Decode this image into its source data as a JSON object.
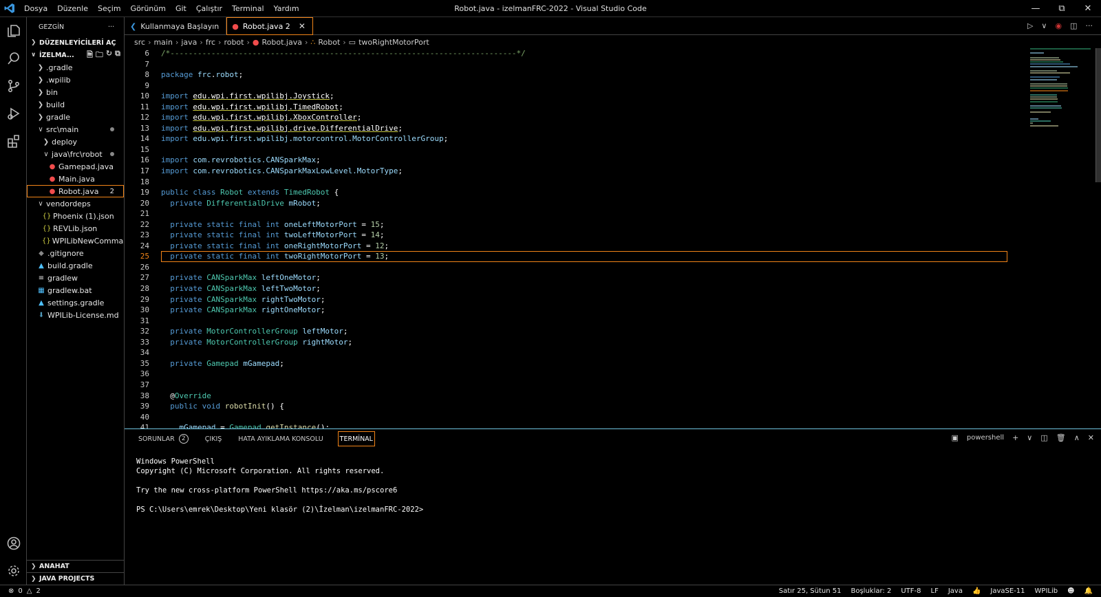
{
  "window": {
    "title": "Robot.java - izelmanFRC-2022 - Visual Studio Code",
    "menu": [
      "Dosya",
      "Düzenle",
      "Seçim",
      "Görünüm",
      "Git",
      "Çalıştır",
      "Terminal",
      "Yardım"
    ]
  },
  "sidebar": {
    "header": "GEZGİN",
    "open_editors": "DÜZENLEYİCİLERİ AÇ",
    "folder": "İZELMA...",
    "tree": [
      {
        "label": ".gradle",
        "depth": 1,
        "kind": "folder",
        "open": false
      },
      {
        "label": ".wpilib",
        "depth": 1,
        "kind": "folder",
        "open": false
      },
      {
        "label": "bin",
        "depth": 1,
        "kind": "folder",
        "open": false
      },
      {
        "label": "build",
        "depth": 1,
        "kind": "folder",
        "open": false
      },
      {
        "label": "gradle",
        "depth": 1,
        "kind": "folder",
        "open": false
      },
      {
        "label": "src\\main",
        "depth": 1,
        "kind": "folder",
        "open": true,
        "dot": true
      },
      {
        "label": "deploy",
        "depth": 2,
        "kind": "folder",
        "open": false
      },
      {
        "label": "java\\frc\\robot",
        "depth": 2,
        "kind": "folder",
        "open": true,
        "dot": true
      },
      {
        "label": "Gamepad.java",
        "depth": 3,
        "kind": "java-error"
      },
      {
        "label": "Main.java",
        "depth": 3,
        "kind": "java-error"
      },
      {
        "label": "Robot.java",
        "depth": 3,
        "kind": "java-error",
        "selected": true,
        "count": "2"
      },
      {
        "label": "vendordeps",
        "depth": 1,
        "kind": "folder",
        "open": true
      },
      {
        "label": "Phoenix (1).json",
        "depth": 2,
        "kind": "json"
      },
      {
        "label": "REVLib.json",
        "depth": 2,
        "kind": "json"
      },
      {
        "label": "WPILibNewComma...",
        "depth": 2,
        "kind": "json"
      },
      {
        "label": ".gitignore",
        "depth": 1,
        "kind": "git"
      },
      {
        "label": "build.gradle",
        "depth": 1,
        "kind": "gradle"
      },
      {
        "label": "gradlew",
        "depth": 1,
        "kind": "text"
      },
      {
        "label": "gradlew.bat",
        "depth": 1,
        "kind": "bat"
      },
      {
        "label": "settings.gradle",
        "depth": 1,
        "kind": "gradle"
      },
      {
        "label": "WPILib-License.md",
        "depth": 1,
        "kind": "md"
      }
    ],
    "outline": "ANAHAT",
    "java_projects": "JAVA PROJECTS"
  },
  "tabs": [
    {
      "label": "Kullanmaya Başlayın",
      "active": false
    },
    {
      "label": "Robot.java 2",
      "active": true
    }
  ],
  "breadcrumb": [
    "src",
    "main",
    "java",
    "frc",
    "robot",
    "Robot.java",
    "Robot",
    "twoRightMotorPort"
  ],
  "editor": {
    "current_line": 25,
    "lines": [
      {
        "n": 6,
        "t": [
          [
            "cm",
            "/*----------------------------------------------------------------------------*/"
          ]
        ]
      },
      {
        "n": 7,
        "t": []
      },
      {
        "n": 8,
        "t": [
          [
            "kw",
            "package "
          ],
          [
            "id",
            "frc"
          ],
          [
            "",
            "."
          ],
          [
            "id",
            "robot"
          ],
          [
            "",
            ";"
          ]
        ]
      },
      {
        "n": 9,
        "t": []
      },
      {
        "n": 10,
        "t": [
          [
            "kw",
            "import "
          ],
          [
            "ul",
            "edu.wpi.first.wpilibj.Joystick"
          ],
          [
            "",
            ";"
          ]
        ]
      },
      {
        "n": 11,
        "t": [
          [
            "kw",
            "import "
          ],
          [
            "ul",
            "edu.wpi.first.wpilibj.TimedRobot"
          ],
          [
            "",
            ";"
          ]
        ]
      },
      {
        "n": 12,
        "t": [
          [
            "kw",
            "import "
          ],
          [
            "ul",
            "edu.wpi.first.wpilibj.XboxController"
          ],
          [
            "",
            ";"
          ]
        ]
      },
      {
        "n": 13,
        "t": [
          [
            "kw",
            "import "
          ],
          [
            "ul",
            "edu.wpi.first.wpilibj.drive.DifferentialDrive"
          ],
          [
            "",
            ";"
          ]
        ]
      },
      {
        "n": 14,
        "t": [
          [
            "kw",
            "import "
          ],
          [
            "id",
            "edu.wpi.first.wpilibj.motorcontrol.MotorControllerGroup"
          ],
          [
            "",
            ";"
          ]
        ]
      },
      {
        "n": 15,
        "t": []
      },
      {
        "n": 16,
        "t": [
          [
            "kw",
            "import "
          ],
          [
            "id",
            "com.revrobotics.CANSparkMax"
          ],
          [
            "",
            ";"
          ]
        ]
      },
      {
        "n": 17,
        "t": [
          [
            "kw",
            "import "
          ],
          [
            "id",
            "com.revrobotics.CANSparkMaxLowLevel.MotorType"
          ],
          [
            "",
            ";"
          ]
        ]
      },
      {
        "n": 18,
        "t": []
      },
      {
        "n": 19,
        "t": [
          [
            "kw",
            "public class "
          ],
          [
            "ty",
            "Robot"
          ],
          [
            "kw",
            " extends "
          ],
          [
            "ty",
            "TimedRobot"
          ],
          [
            "",
            " {"
          ]
        ]
      },
      {
        "n": 20,
        "t": [
          [
            "",
            "  "
          ],
          [
            "kw",
            "private "
          ],
          [
            "ty",
            "DifferentialDrive"
          ],
          [
            "",
            " "
          ],
          [
            "id",
            "mRobot"
          ],
          [
            "",
            ";"
          ]
        ]
      },
      {
        "n": 21,
        "t": []
      },
      {
        "n": 22,
        "t": [
          [
            "",
            "  "
          ],
          [
            "kw",
            "private static final int "
          ],
          [
            "id",
            "oneLeftMotorPort"
          ],
          [
            "",
            " = "
          ],
          [
            "nu",
            "15"
          ],
          [
            "",
            ";"
          ]
        ]
      },
      {
        "n": 23,
        "t": [
          [
            "",
            "  "
          ],
          [
            "kw",
            "private static final int "
          ],
          [
            "id",
            "twoLeftMotorPort"
          ],
          [
            "",
            " = "
          ],
          [
            "nu",
            "14"
          ],
          [
            "",
            ";"
          ]
        ]
      },
      {
        "n": 24,
        "t": [
          [
            "",
            "  "
          ],
          [
            "kw",
            "private static final int "
          ],
          [
            "id",
            "oneRightMotorPort"
          ],
          [
            "",
            " = "
          ],
          [
            "nu",
            "12"
          ],
          [
            "",
            ";"
          ]
        ]
      },
      {
        "n": 25,
        "t": [
          [
            "",
            "  "
          ],
          [
            "kw",
            "private static final int "
          ],
          [
            "id",
            "twoRightMotorPort"
          ],
          [
            "",
            " = "
          ],
          [
            "nu",
            "13"
          ],
          [
            "",
            ";"
          ]
        ]
      },
      {
        "n": 26,
        "t": []
      },
      {
        "n": 27,
        "t": [
          [
            "",
            "  "
          ],
          [
            "kw",
            "private "
          ],
          [
            "ty",
            "CANSparkMax"
          ],
          [
            "",
            " "
          ],
          [
            "id",
            "leftOneMotor"
          ],
          [
            "",
            ";"
          ]
        ]
      },
      {
        "n": 28,
        "t": [
          [
            "",
            "  "
          ],
          [
            "kw",
            "private "
          ],
          [
            "ty",
            "CANSparkMax"
          ],
          [
            "",
            " "
          ],
          [
            "id",
            "leftTwoMotor"
          ],
          [
            "",
            ";"
          ]
        ]
      },
      {
        "n": 29,
        "t": [
          [
            "",
            "  "
          ],
          [
            "kw",
            "private "
          ],
          [
            "ty",
            "CANSparkMax"
          ],
          [
            "",
            " "
          ],
          [
            "id",
            "rightTwoMotor"
          ],
          [
            "",
            ";"
          ]
        ]
      },
      {
        "n": 30,
        "t": [
          [
            "",
            "  "
          ],
          [
            "kw",
            "private "
          ],
          [
            "ty",
            "CANSparkMax"
          ],
          [
            "",
            " "
          ],
          [
            "id",
            "rightOneMotor"
          ],
          [
            "",
            ";"
          ]
        ]
      },
      {
        "n": 31,
        "t": []
      },
      {
        "n": 32,
        "t": [
          [
            "",
            "  "
          ],
          [
            "kw",
            "private "
          ],
          [
            "ty",
            "MotorControllerGroup"
          ],
          [
            "",
            " "
          ],
          [
            "id",
            "leftMotor"
          ],
          [
            "",
            ";"
          ]
        ]
      },
      {
        "n": 33,
        "t": [
          [
            "",
            "  "
          ],
          [
            "kw",
            "private "
          ],
          [
            "ty",
            "MotorControllerGroup"
          ],
          [
            "",
            " "
          ],
          [
            "id",
            "rightMotor"
          ],
          [
            "",
            ";"
          ]
        ]
      },
      {
        "n": 34,
        "t": []
      },
      {
        "n": 35,
        "t": [
          [
            "",
            "  "
          ],
          [
            "kw",
            "private "
          ],
          [
            "ty",
            "Gamepad"
          ],
          [
            "",
            " "
          ],
          [
            "id",
            "mGamepad"
          ],
          [
            "",
            ";"
          ]
        ]
      },
      {
        "n": 36,
        "t": []
      },
      {
        "n": 37,
        "t": []
      },
      {
        "n": 38,
        "t": [
          [
            "",
            "  "
          ],
          [
            "",
            "@"
          ],
          [
            "ty",
            "Override"
          ]
        ]
      },
      {
        "n": 39,
        "t": [
          [
            "",
            "  "
          ],
          [
            "kw",
            "public void "
          ],
          [
            "fn",
            "robotInit"
          ],
          [
            "",
            "() {"
          ]
        ]
      },
      {
        "n": 40,
        "t": [
          [
            "",
            "    "
          ]
        ]
      },
      {
        "n": 41,
        "t": [
          [
            "",
            "    "
          ],
          [
            "id",
            "mGamepad"
          ],
          [
            "",
            " = "
          ],
          [
            "ty",
            "Gamepad"
          ],
          [
            "",
            "."
          ],
          [
            "fn",
            "getInstance"
          ],
          [
            "",
            "();"
          ]
        ]
      }
    ]
  },
  "panel": {
    "tabs": [
      {
        "label": "SORUNLAR",
        "badge": "2",
        "active": false
      },
      {
        "label": "ÇIKIŞ",
        "active": false
      },
      {
        "label": "HATA AYIKLAMA KONSOLU",
        "active": false
      },
      {
        "label": "TERMİNAL",
        "active": true
      }
    ],
    "shell": "powershell",
    "terminal_lines": [
      "Windows PowerShell",
      "Copyright (C) Microsoft Corporation. All rights reserved.",
      "",
      "Try the new cross-platform PowerShell https://aka.ms/pscore6",
      "",
      "PS C:\\Users\\emrek\\Desktop\\Yeni klasör (2)\\İzelman\\izelmanFRC-2022>"
    ]
  },
  "statusbar": {
    "errors": "0",
    "warnings": "2",
    "position": "Satır 25, Sütun 51",
    "spaces": "Boşluklar: 2",
    "encoding": "UTF-8",
    "eol": "LF",
    "language": "Java",
    "jdk": "JavaSE-11",
    "wpilib": "WPILib"
  },
  "colors": {
    "accent": "#f38518",
    "panel_border": "#6fc3df",
    "error": "#f14c4c"
  }
}
